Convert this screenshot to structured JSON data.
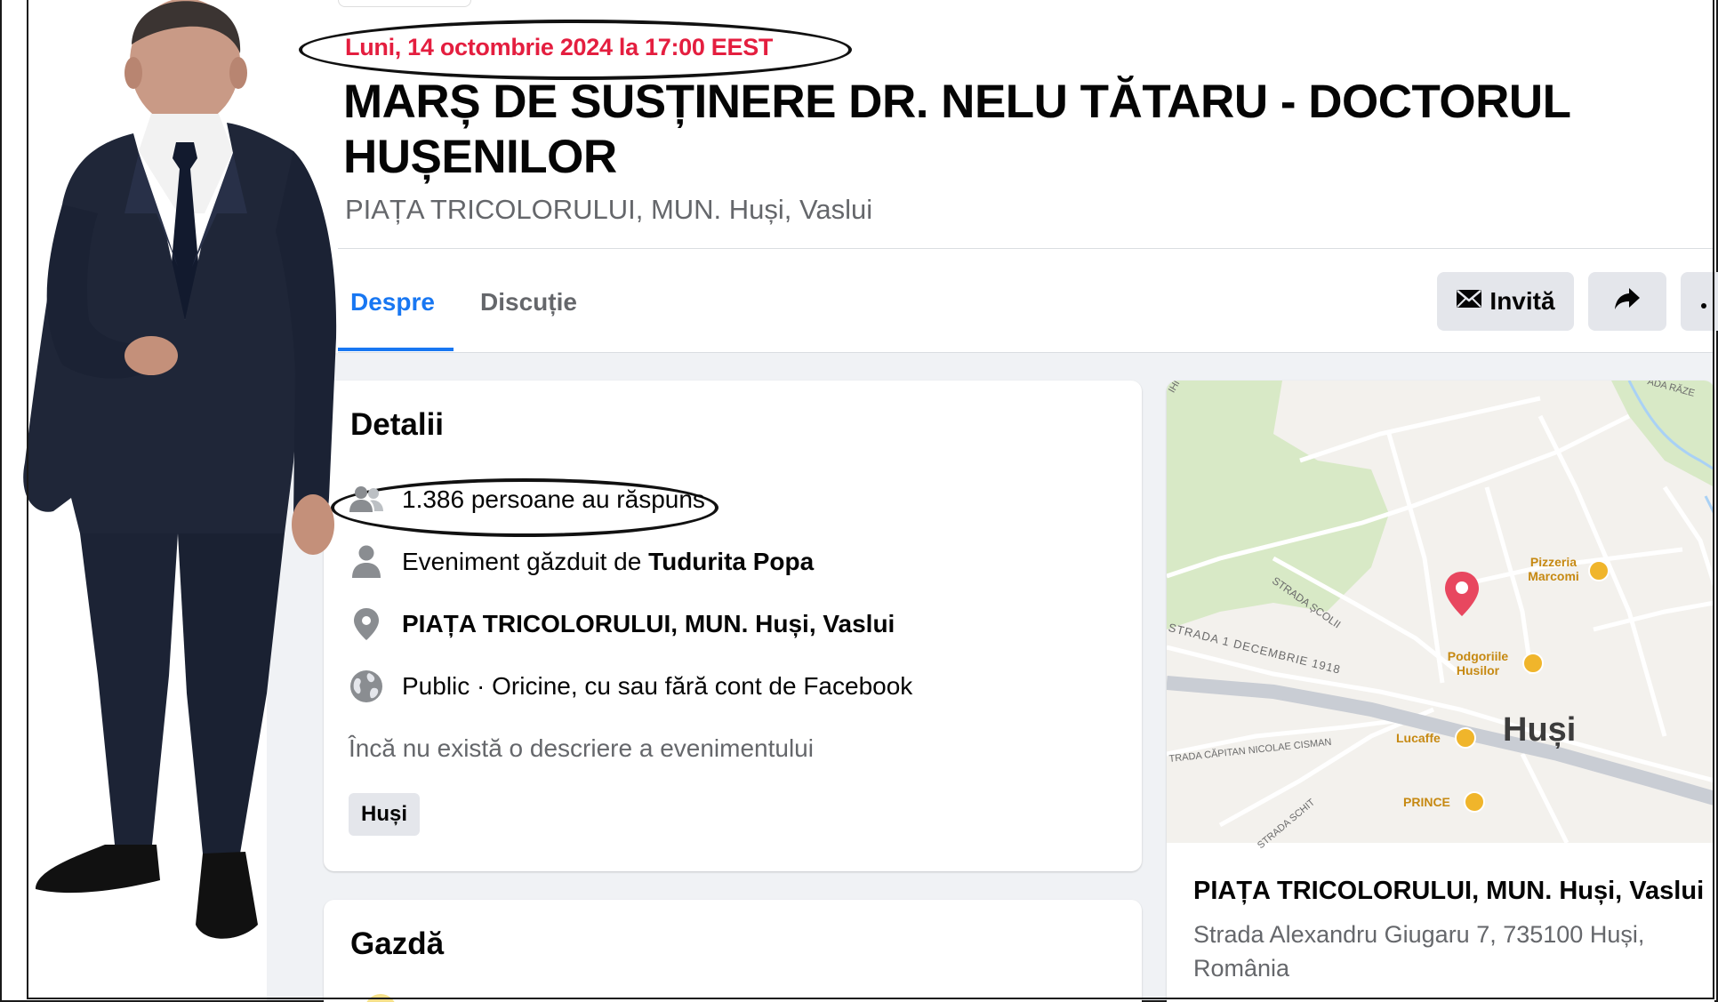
{
  "event": {
    "date": "Luni, 14 octombrie 2024 la 17:00 EEST",
    "title": "MARȘ DE SUSȚINERE DR. NELU TĂTARU - DOCTORUL HUȘENILOR",
    "location": "PIAȚA TRICOLORULUI, MUN. Huși, Vaslui"
  },
  "tabs": [
    {
      "label": "Despre",
      "active": true
    },
    {
      "label": "Discuție",
      "active": false
    }
  ],
  "actions": {
    "invite_label": "Invită",
    "invite_icon": "envelope-icon",
    "share_icon": "share-arrow-icon",
    "more_icon": "more-dots-icon"
  },
  "details": {
    "heading": "Detalii",
    "responses": "1.386 persoane au răspuns",
    "host_prefix": "Eveniment găzduit de ",
    "host_name": "Tudurita Popa",
    "location": "PIAȚA TRICOLORULUI, MUN. Huși, Vaslui",
    "privacy": "Public · Oricine, cu sau fără cont de Facebook",
    "no_description": "Încă nu există o descriere a evenimentului",
    "tag": "Huși"
  },
  "host_card": {
    "heading": "Gazdă"
  },
  "map": {
    "city_label": "Huși",
    "places": [
      "Pizzeria Marcomi",
      "Podgoriile Husilor",
      "Lucaffe",
      "PRINCE"
    ],
    "streets": [
      "STRADA ȘCOLII",
      "STRADA 1 DECEMBRIE 1918",
      "TRADA CĂPITAN NICOLAE CISMAN",
      "STRADA SCHIT",
      "ADA RĂZE",
      "IHITESCU"
    ],
    "caption_title": "PIAȚA TRICOLORULUI, MUN. Huși, Vaslui",
    "caption_address": "Strada Alexandru Giugaru 7, 735100 Huși, România"
  },
  "colors": {
    "accent": "#1877f2",
    "date_red": "#e41e3f",
    "pin_red": "#e8475f",
    "poi_orange": "#e8a317"
  }
}
